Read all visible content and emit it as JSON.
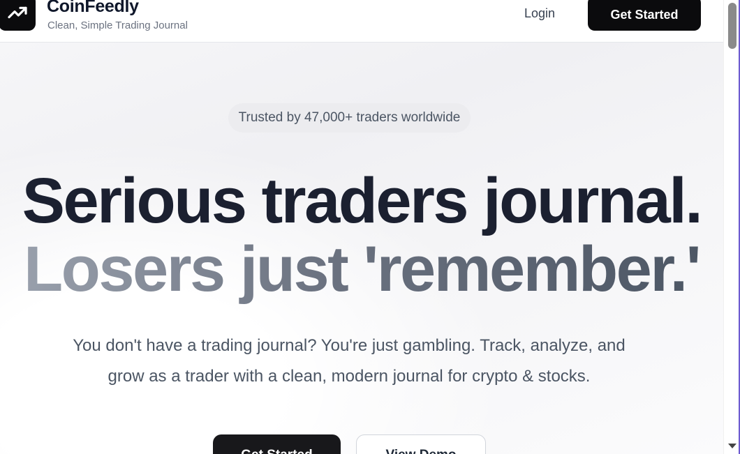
{
  "header": {
    "brand_name": "CoinFeedly",
    "brand_tagline": "Clean, Simple Trading Journal",
    "logo_icon": "trending-up-icon",
    "login_label": "Login",
    "cta_label": "Get Started"
  },
  "hero": {
    "badge": "Trusted by 47,000+ traders worldwide",
    "headline_line1": "Serious traders journal.",
    "headline_line2": "Losers just 'remember.'",
    "subtext_line1": "You don't have a trading journal? You're just gambling. Track, analyze, and",
    "subtext_line2": "grow as a trader with a clean, modern journal for crypto & stocks.",
    "primary_cta": "Get Started",
    "secondary_cta": "View Demo"
  },
  "colors": {
    "primary": "#0b0b0d",
    "headline": "#1b2030",
    "muted": "#6b7280"
  }
}
